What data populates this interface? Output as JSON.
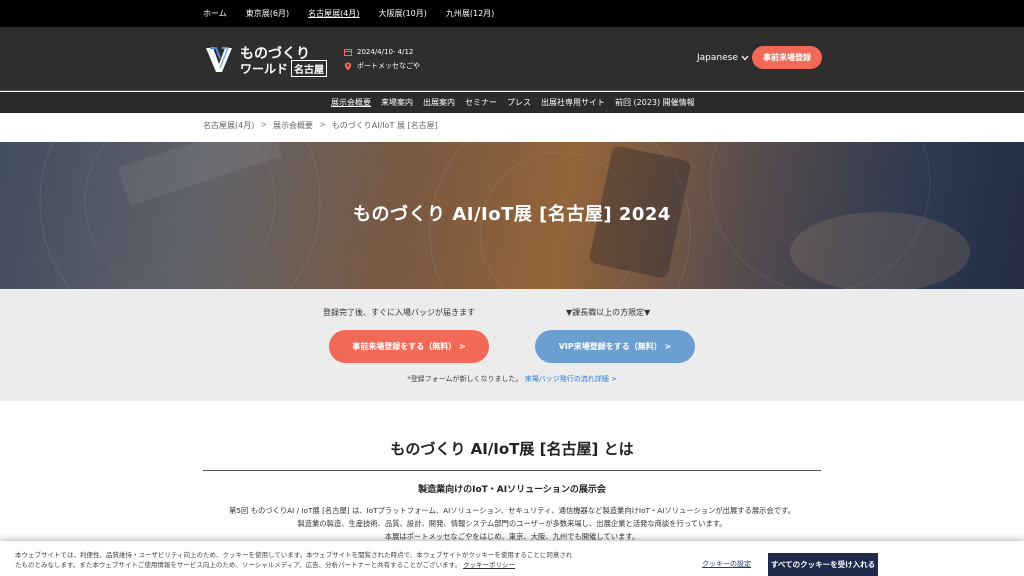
{
  "topbar": {
    "items": [
      {
        "label": "ホーム"
      },
      {
        "label": "東京展(6月)"
      },
      {
        "label": "名古屋展(4月)"
      },
      {
        "label": "大阪展(10月)"
      },
      {
        "label": "九州展(12月)"
      }
    ],
    "active_index": 2
  },
  "header": {
    "logo_line1": "ものづくり",
    "logo_line2": "ワールド",
    "logo_city": "名古屋",
    "date": "2024/4/10- 4/12",
    "venue": "ポートメッセなごや",
    "language": "Japanese",
    "register_label": "事前来場登録",
    "icons": [
      "calendar-icon",
      "location-pin-icon",
      "chevron-down-icon"
    ],
    "accent_color": "#f26a57"
  },
  "nav": {
    "items": [
      {
        "label": "展示会概要"
      },
      {
        "label": "来場案内"
      },
      {
        "label": "出展案内"
      },
      {
        "label": "セミナー"
      },
      {
        "label": "プレス"
      },
      {
        "label": "出展社専用サイト"
      },
      {
        "label": "前回 (2023) 開催情報"
      }
    ],
    "active_index": 0
  },
  "breadcrumb": {
    "items": [
      "名古屋展(4月)",
      "展示会概要",
      "ものづくりAI/IoT 展 [名古屋]"
    ],
    "separator": ">"
  },
  "hero": {
    "title": "ものづくり AI/IoT展 [名古屋] 2024"
  },
  "registration": {
    "caption_standard": "登録完了後、すぐに入場バッジが届きます",
    "caption_vip": "▼課長職以上の方限定▼",
    "standard_button": "事前来場登録をする（無料） >",
    "vip_button": "VIP来場登録をする（無料） >",
    "note_text": "*登録フォームが新しくなりました。",
    "note_link": "来場バッジ発行の流れ詳細 >",
    "standard_color": "#f26a57",
    "vip_color": "#6b9fd1"
  },
  "about": {
    "title": "ものづくり AI/IoT展 [名古屋] とは",
    "subtitle": "製造業向けのIoT・AIソリューションの展示会",
    "line1": "第5回 ものづくりAI / IoT展 [名古屋] は、IoTプラットフォーム、AIソリューション、セキュリティ、通信機器など製造業向けIoT・AIソリューションが出展する展示会です。",
    "line2": "製造業の製造、生産技術、品質、設計、開発、情報システム部門のユーザーが多数来場し、出展企業と活発な商談を行っています。",
    "line3": "本展はポートメッセなごやをはじめ、東京、大阪、九州でも開催しています。"
  },
  "cookie": {
    "text": "本ウェブサイトでは、利便性、品質維持・ユーザビリティ向上のため、クッキーを使用しています。本ウェブサイトを閲覧された時点で、本ウェブサイトがクッキーを使用することに同意されたものとみなします。また本ウェブサイトご使用情報をサービス向上のため、ソーシャルメディア、広告、分析パートナーと共有することがございます。",
    "link": "クッキーポリシー",
    "settings_label": "クッキーの設定",
    "accept_label": "すべてのクッキーを受け入れる"
  }
}
